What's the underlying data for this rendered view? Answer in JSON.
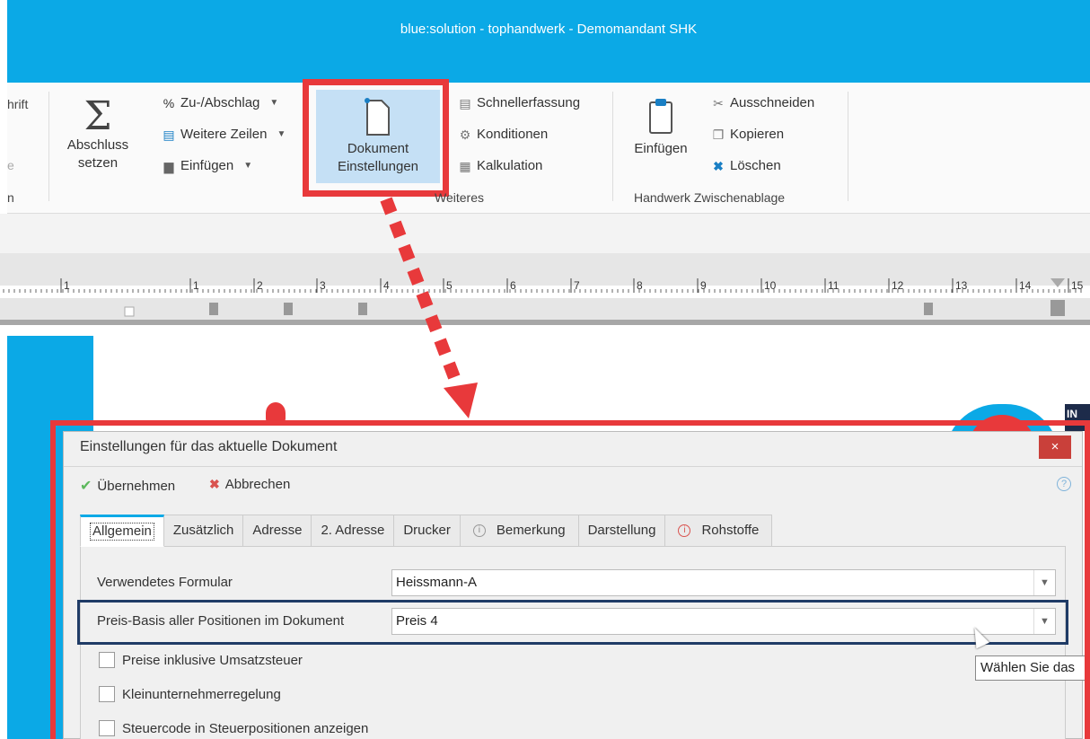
{
  "window": {
    "title": "blue:solution - tophandwerk -  Demomandant SHK"
  },
  "ribbon": {
    "partial_left": {
      "line1": "hrift",
      "line2": "e",
      "line3": "n"
    },
    "abschluss": {
      "line1": "Abschluss",
      "line2": "setzen"
    },
    "zu_abschlag": "Zu-/Abschlag",
    "weitere_zeilen": "Weitere Zeilen",
    "einfuegen_small": "Einfügen",
    "dokument": {
      "line1": "Dokument",
      "line2": "Einstellungen"
    },
    "schnellerfassung": "Schnellerfassung",
    "konditionen": "Konditionen",
    "kalkulation": "Kalkulation",
    "weiteres_label": "Weiteres",
    "einfuegen_big": "Einfügen",
    "ausschneiden": "Ausschneiden",
    "kopieren": "Kopieren",
    "loeschen": "Löschen",
    "zwischenablage_label": "Handwerk Zwischenablage"
  },
  "ruler": {
    "numbers": [
      "1",
      "1",
      "2",
      "3",
      "4",
      "5",
      "6",
      "7",
      "8",
      "9",
      "10",
      "11",
      "12",
      "13",
      "14",
      "15"
    ]
  },
  "logo": {
    "text": "IN"
  },
  "dialog": {
    "title": "Einstellungen für das aktuelle Dokument",
    "close": "×",
    "apply": "Übernehmen",
    "cancel": "Abbrechen",
    "help": "?",
    "tabs": [
      {
        "label": "Allgemein",
        "active": true,
        "info": false
      },
      {
        "label": "Zusätzlich",
        "info": false
      },
      {
        "label": "Adresse",
        "info": false
      },
      {
        "label": "2. Adresse",
        "info": false
      },
      {
        "label": "Drucker",
        "info": false
      },
      {
        "label": "Bemerkung",
        "info": true,
        "info_color": "gray"
      },
      {
        "label": "Darstellung",
        "info": false
      },
      {
        "label": "Rohstoffe",
        "info": true,
        "info_color": "red"
      }
    ],
    "formular_label": "Verwendetes Formular",
    "formular_value": "Heissmann-A",
    "preisbasis_label": "Preis-Basis aller Positionen im Dokument",
    "preisbasis_value": "Preis 4",
    "checkboxes": [
      "Preise inklusive Umsatzsteuer",
      "Kleinunternehmerregelung",
      "Steuercode in Steuerpositionen anzeigen"
    ],
    "tooltip": "Wählen Sie das"
  },
  "colors": {
    "accent": "#0ba9e6",
    "highlight_red": "#e8393b",
    "highlight_navy": "#1f3b66"
  }
}
